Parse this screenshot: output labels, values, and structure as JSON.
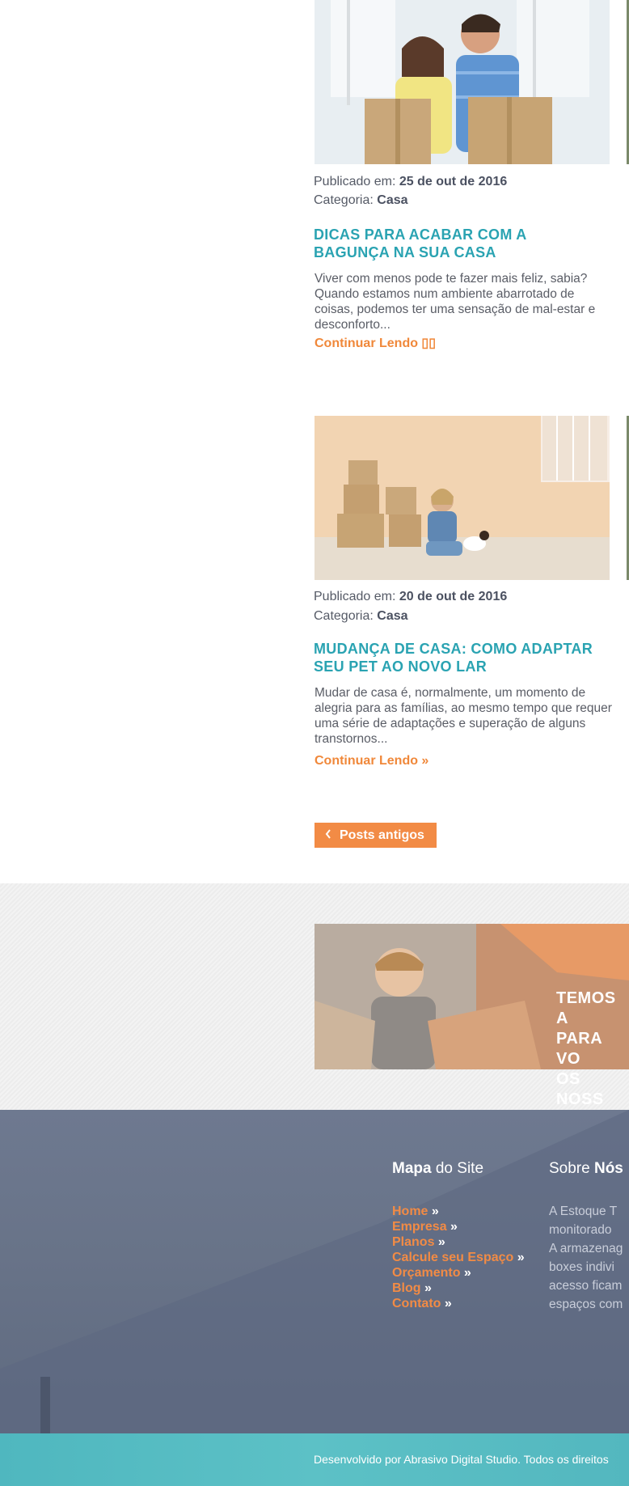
{
  "posts": [
    {
      "published_prefix": "Publicado em:",
      "date": "25 de out de 2016",
      "category_prefix": "Categoria:",
      "category": "Casa",
      "title_line1": "DICAS PARA ACABAR COM A",
      "title_line2": "BAGUNÇA NA SUA CASA",
      "excerpt": "Viver com menos pode te fazer mais feliz, sabia? Quando estamos num ambiente abarrotado de coisas, podemos ter uma sensação de mal-estar e desconforto...",
      "read_more": "Continuar Lendo ▯▯"
    },
    {
      "published_prefix": "Publicado em:",
      "date": "20 de out de 2016",
      "category_prefix": "Categoria:",
      "category": "Casa",
      "title_line1": "MUDANÇA DE CASA: COMO ADAPTAR",
      "title_line2": "SEU PET AO NOVO LAR",
      "excerpt": "Mudar de casa é, normalmente, um momento de alegria para as famílias, ao mesmo tempo que requer uma série de adaptações e superação de alguns transtornos...",
      "read_more": "Continuar Lendo »"
    }
  ],
  "pagination": {
    "older_label": "Posts antigos",
    "icon": "chevron-left-icon"
  },
  "banner": {
    "line1": "TEMOS A",
    "line2": "PARA VO",
    "line3": "OS NOSS"
  },
  "footer": {
    "sitemap_title_bold": "Mapa",
    "sitemap_title_rest": "do Site",
    "sitemap": [
      {
        "label": "Home",
        "arrow": "»"
      },
      {
        "label": "Empresa",
        "arrow": "»"
      },
      {
        "label": "Planos",
        "arrow": "»"
      },
      {
        "label": "Calcule seu Espaço",
        "arrow": "»"
      },
      {
        "label": "Orçamento",
        "arrow": "»"
      },
      {
        "label": "Blog",
        "arrow": "»"
      },
      {
        "label": "Contato",
        "arrow": "»"
      }
    ],
    "about_title_rest": "Sobre",
    "about_title_bold": "Nós",
    "about_lines": [
      "A Estoque T",
      "monitorado",
      "A armazenag",
      "boxes indivi",
      "acesso ficam",
      "espaços com"
    ],
    "credits": "Desenvolvido por Abrasivo Digital Studio. Todos os direitos"
  },
  "colors": {
    "accent_orange": "#f28b45",
    "title_teal": "#2aa3b2",
    "footer_bg": "#6a7589",
    "bottom_bar": "#55bac1"
  }
}
